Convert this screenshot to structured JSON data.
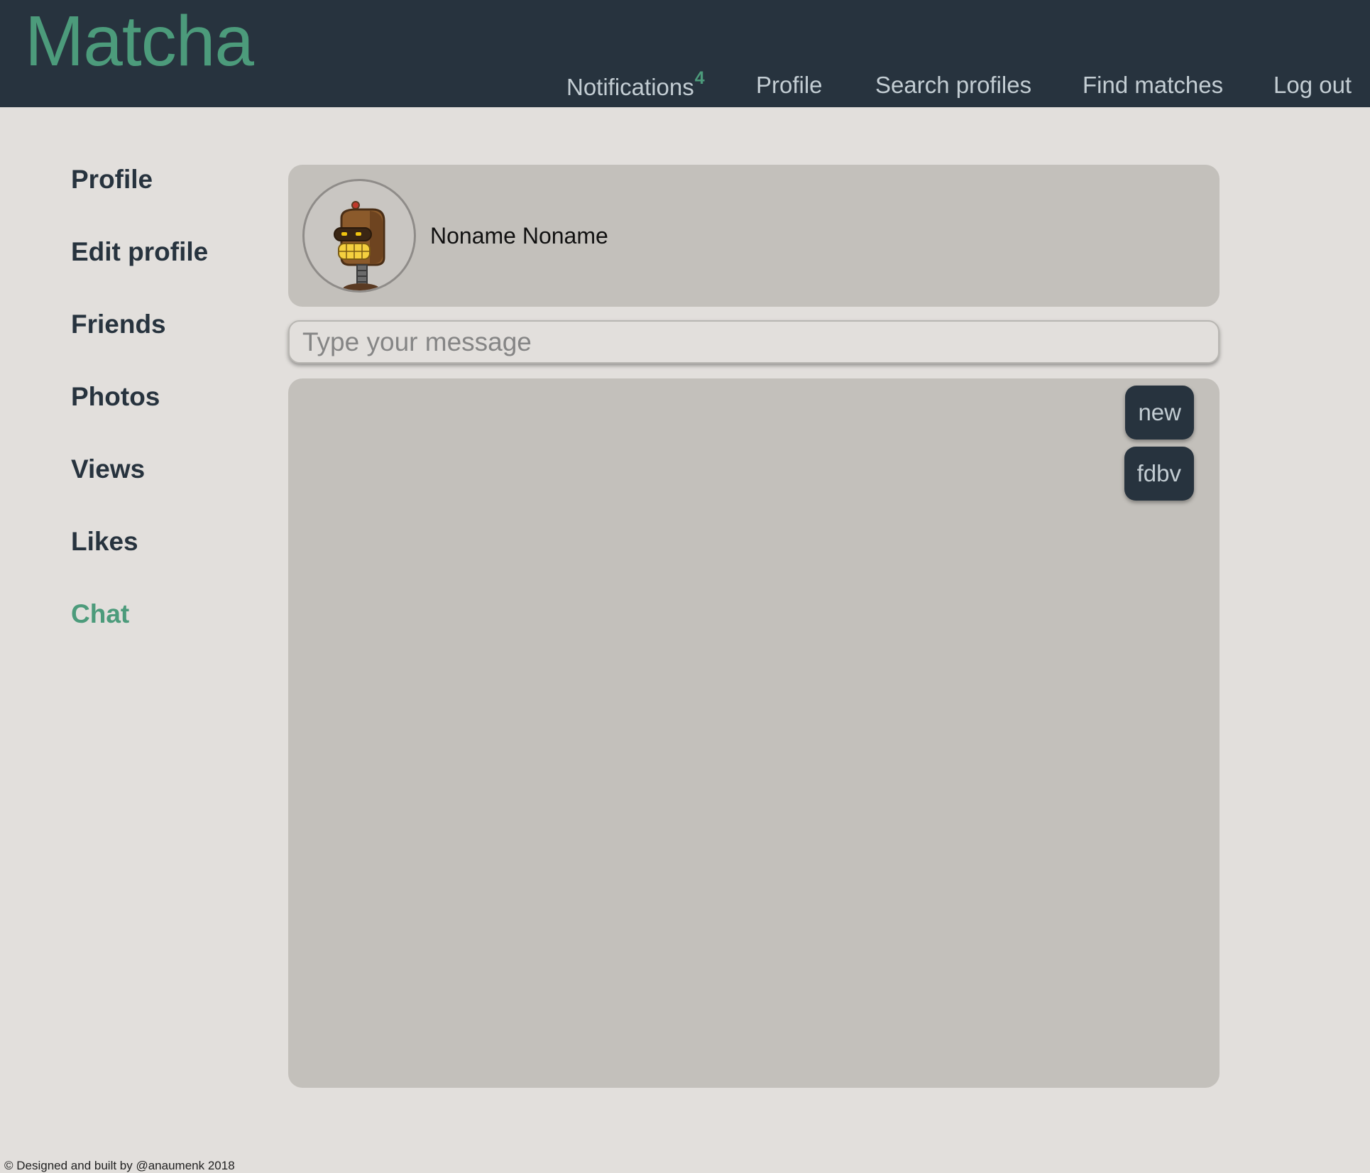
{
  "brand": "Matcha",
  "nav": {
    "notifications_label": "Notifications",
    "notifications_count": "4",
    "profile": "Profile",
    "search_profiles": "Search profiles",
    "find_matches": "Find matches",
    "log_out": "Log out"
  },
  "sidebar": {
    "items": [
      {
        "label": "Profile"
      },
      {
        "label": "Edit profile"
      },
      {
        "label": "Friends"
      },
      {
        "label": "Photos"
      },
      {
        "label": "Views"
      },
      {
        "label": "Likes"
      },
      {
        "label": "Chat",
        "active": true
      }
    ]
  },
  "chat": {
    "partner_name": "Noname Noname",
    "avatar_icon": "robot-avatar-icon",
    "input_placeholder": "Type your message",
    "messages": [
      {
        "text": "new",
        "side": "right"
      },
      {
        "text": "fdbv",
        "side": "right"
      }
    ]
  },
  "footer": {
    "text": "© Designed and built by @anaumenk 2018"
  },
  "colors": {
    "topbar_bg": "#27333e",
    "accent": "#4c9b7b",
    "page_bg": "#e2dfdc",
    "panel_bg": "#c3c0bb",
    "nav_text": "#c3cdd3"
  }
}
